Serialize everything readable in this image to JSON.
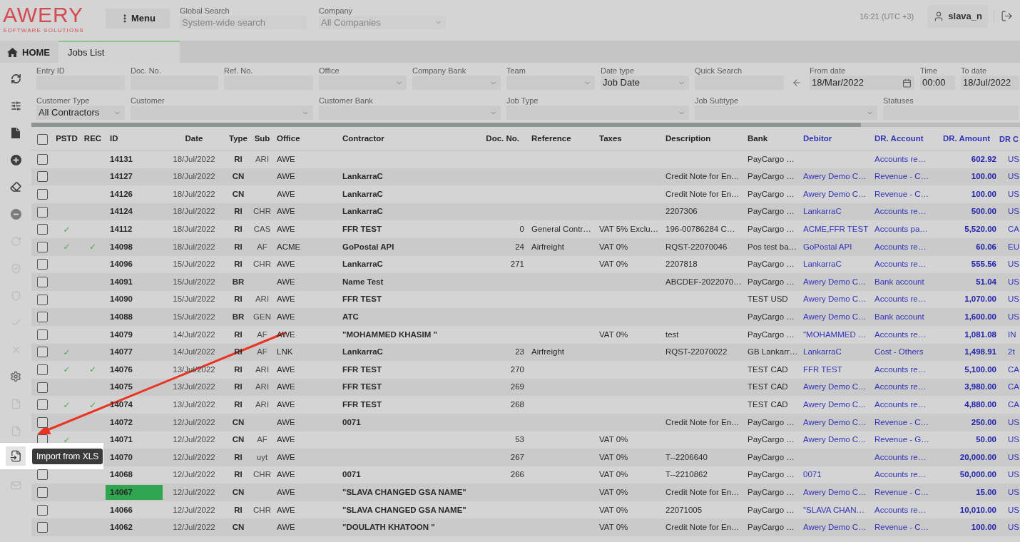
{
  "header": {
    "logo": {
      "name": "AWERY",
      "tagline": "SOFTWARE SOLUTIONS"
    },
    "menu_button": "Menu",
    "global_search": {
      "label": "Global Search",
      "placeholder": "System-wide search"
    },
    "company": {
      "label": "Company",
      "placeholder": "All Companies"
    },
    "time": "16:21 (UTC +3)",
    "user": "slava_n"
  },
  "tabs": [
    {
      "label": "HOME",
      "kind": "home",
      "selected": false
    },
    {
      "label": "Jobs List",
      "kind": "page",
      "selected": true
    }
  ],
  "sidebar": {
    "items": [
      {
        "kind": "refresh",
        "disabled": false
      },
      {
        "kind": "filters",
        "disabled": false
      },
      {
        "kind": "document",
        "disabled": false
      },
      {
        "kind": "add",
        "disabled": false
      },
      {
        "kind": "eraser",
        "disabled": false
      },
      {
        "kind": "remove",
        "disabled": false
      },
      {
        "kind": "redo",
        "disabled": true
      },
      {
        "kind": "shield_check",
        "disabled": true
      },
      {
        "kind": "shield",
        "disabled": true
      },
      {
        "kind": "check",
        "disabled": true
      },
      {
        "kind": "close",
        "disabled": true
      },
      {
        "kind": "settings",
        "disabled": false
      },
      {
        "kind": "export",
        "disabled": true
      },
      {
        "kind": "export",
        "disabled": true
      },
      {
        "kind": "import",
        "disabled": false,
        "tooltip": "Import from XLS"
      },
      {
        "kind": "mail",
        "disabled": true
      }
    ]
  },
  "filters": {
    "fields": [
      {
        "kind": "text",
        "label": "Entry ID"
      },
      {
        "kind": "text",
        "label": "Doc. No."
      },
      {
        "kind": "text",
        "label": "Ref. No."
      },
      {
        "kind": "select",
        "label": "Office"
      },
      {
        "kind": "select",
        "label": "Company Bank"
      },
      {
        "kind": "select",
        "label": "Team"
      },
      {
        "kind": "select",
        "label": "Date type",
        "value": "Job Date"
      },
      {
        "kind": "text",
        "label": "Quick Search"
      },
      {
        "kind": "arrow_button"
      },
      {
        "kind": "date",
        "label": "From date",
        "value": "18/Mar/2022"
      },
      {
        "kind": "time",
        "label": "Time",
        "value": "00:00"
      },
      {
        "kind": "time",
        "label": "To date",
        "value": "18/Jul/2022"
      },
      {
        "kind": "select",
        "label": "Customer Type",
        "value": "All Contractors"
      },
      {
        "kind": "select",
        "label": "Customer"
      },
      {
        "kind": "select",
        "label": "Customer Bank"
      },
      {
        "kind": "select",
        "label": "Job Type"
      },
      {
        "kind": "select",
        "label": "Job Subtype"
      },
      {
        "kind": "text",
        "label": "Statuses"
      }
    ]
  },
  "table": {
    "all_checked": false,
    "columns": [
      {
        "label": "PSTD",
        "kind": "tick"
      },
      {
        "label": "REC",
        "kind": "tick"
      },
      {
        "label": "ID",
        "kind": "id"
      },
      {
        "label": "Date",
        "kind": "date"
      },
      {
        "label": "Type",
        "kind": "type"
      },
      {
        "label": "Sub",
        "kind": "sub"
      },
      {
        "label": "Office",
        "kind": "text"
      },
      {
        "label": "Contractor",
        "kind": "name"
      },
      {
        "label": "Doc. No.",
        "kind": "number"
      },
      {
        "label": "Reference",
        "kind": "text"
      },
      {
        "label": "Taxes",
        "kind": "text"
      },
      {
        "label": "Description",
        "kind": "text"
      },
      {
        "label": "Bank",
        "kind": "text"
      },
      {
        "label": "Debitor",
        "kind": "link"
      },
      {
        "label": "DR. Account",
        "kind": "link"
      },
      {
        "label": "DR. Amount",
        "kind": "amount"
      },
      {
        "label": "DR C",
        "kind": "currency"
      }
    ],
    "rows": [
      {
        "checked": false,
        "id_highlighted": false,
        "cells": [
          "",
          "",
          "14131",
          "18/Jul/2022",
          "RI",
          "ARI",
          "AWE",
          "",
          "",
          "",
          "",
          "",
          "PayCargo …",
          "",
          "Accounts re…",
          "602.92",
          "US"
        ]
      },
      {
        "checked": false,
        "id_highlighted": false,
        "cells": [
          "",
          "",
          "14127",
          "18/Jul/2022",
          "CN",
          "",
          "AWE",
          "LankarraC",
          "",
          "",
          "",
          "Credit Note for En…",
          "PayCargo …",
          "Awery Demo C…",
          "Revenue - C…",
          "100.00",
          "US"
        ]
      },
      {
        "checked": false,
        "id_highlighted": false,
        "cells": [
          "",
          "",
          "14126",
          "18/Jul/2022",
          "CN",
          "",
          "AWE",
          "LankarraC",
          "",
          "",
          "",
          "Credit Note for En…",
          "PayCargo …",
          "Awery Demo C…",
          "Revenue - C…",
          "100.00",
          "US"
        ]
      },
      {
        "checked": false,
        "id_highlighted": false,
        "cells": [
          "",
          "",
          "14124",
          "18/Jul/2022",
          "RI",
          "CHR",
          "AWE",
          "LankarraC",
          "",
          "",
          "",
          "2207306",
          "PayCargo …",
          "LankarraC",
          "Accounts re…",
          "500.00",
          "US"
        ]
      },
      {
        "checked": false,
        "id_highlighted": false,
        "cells": [
          "✓",
          "",
          "14112",
          "18/Jul/2022",
          "RI",
          "CAS",
          "AWE",
          "FFR TEST",
          "0",
          "General Contr…",
          "VAT 5% Exclu…",
          "196-00786284 C…",
          "PayCargo …",
          "ACME,FFR TEST",
          "Accounts pa…",
          "5,520.00",
          "CA"
        ]
      },
      {
        "checked": false,
        "id_highlighted": false,
        "cells": [
          "✓",
          "✓",
          "14098",
          "18/Jul/2022",
          "RI",
          "AF",
          "ACME",
          "GoPostal API",
          "24",
          "Airfreight",
          "VAT 0%",
          "RQST-22070046",
          "Pos test ba…",
          "GoPostal API",
          "Accounts re…",
          "60.06",
          "EU"
        ]
      },
      {
        "checked": false,
        "id_highlighted": false,
        "cells": [
          "",
          "",
          "14096",
          "15/Jul/2022",
          "RI",
          "CHR",
          "AWE",
          "LankarraC",
          "271",
          "",
          "VAT 0%",
          "2207818",
          "PayCargo …",
          "LankarraC",
          "Accounts re…",
          "555.56",
          "US"
        ]
      },
      {
        "checked": false,
        "id_highlighted": false,
        "cells": [
          "",
          "",
          "14091",
          "15/Jul/2022",
          "BR",
          "",
          "AWE",
          "Name Test",
          "",
          "",
          "",
          "ABCDEF-2022070…",
          "PayCargo …",
          "Awery Demo C…",
          "Bank account",
          "51.04",
          "US"
        ]
      },
      {
        "checked": false,
        "id_highlighted": false,
        "cells": [
          "",
          "",
          "14090",
          "15/Jul/2022",
          "RI",
          "ARI",
          "AWE",
          "FFR TEST",
          "",
          "",
          "",
          "",
          "TEST USD",
          "Awery Demo C…",
          "Accounts re…",
          "1,070.00",
          "US"
        ]
      },
      {
        "checked": false,
        "id_highlighted": false,
        "cells": [
          "",
          "",
          "14088",
          "15/Jul/2022",
          "BR",
          "GEN",
          "AWE",
          "ATC",
          "",
          "",
          "",
          "",
          "PayCargo …",
          "Awery Demo C…",
          "Bank account",
          "1,600.00",
          "US"
        ]
      },
      {
        "checked": false,
        "id_highlighted": false,
        "cells": [
          "",
          "",
          "14079",
          "14/Jul/2022",
          "RI",
          "AF",
          "AWE",
          "\"MOHAMMED KHASIM \"",
          "",
          "",
          "VAT 0%",
          "test",
          "PayCargo …",
          "\"MOHAMMED …",
          "Accounts re…",
          "1,081.08",
          "IN"
        ]
      },
      {
        "checked": false,
        "id_highlighted": false,
        "cells": [
          "✓",
          "",
          "14077",
          "14/Jul/2022",
          "RI",
          "AF",
          "LNK",
          "LankarraC",
          "23",
          "Airfreight",
          "",
          "RQST-22070022",
          "GB Lankarr…",
          "LankarraC",
          "Cost - Others",
          "1,498.91",
          "2t"
        ]
      },
      {
        "checked": false,
        "id_highlighted": false,
        "cells": [
          "✓",
          "✓",
          "14076",
          "13/Jul/2022",
          "RI",
          "ARI",
          "AWE",
          "FFR TEST",
          "270",
          "",
          "",
          "",
          "TEST CAD",
          "FFR TEST",
          "Accounts re…",
          "5,100.00",
          "CA"
        ]
      },
      {
        "checked": false,
        "id_highlighted": false,
        "cells": [
          "",
          "",
          "14075",
          "13/Jul/2022",
          "RI",
          "ARI",
          "AWE",
          "FFR TEST",
          "269",
          "",
          "",
          "",
          "TEST CAD",
          "Awery Demo C…",
          "Accounts re…",
          "3,980.00",
          "CA"
        ]
      },
      {
        "checked": false,
        "id_highlighted": false,
        "cells": [
          "✓",
          "✓",
          "14074",
          "13/Jul/2022",
          "RI",
          "ARI",
          "AWE",
          "FFR TEST",
          "268",
          "",
          "",
          "",
          "TEST CAD",
          "Awery Demo C…",
          "Accounts re…",
          "4,880.00",
          "CA"
        ]
      },
      {
        "checked": false,
        "id_highlighted": false,
        "cells": [
          "",
          "",
          "14072",
          "12/Jul/2022",
          "CN",
          "",
          "AWE",
          "0071",
          "",
          "",
          "",
          "Credit Note for En…",
          "PayCargo …",
          "Awery Demo C…",
          "Revenue - C…",
          "250.00",
          "US"
        ]
      },
      {
        "checked": false,
        "id_highlighted": false,
        "cells": [
          "✓",
          "",
          "14071",
          "12/Jul/2022",
          "CN",
          "AF",
          "AWE",
          "",
          "53",
          "",
          "VAT 0%",
          "",
          "PayCargo …",
          "Awery Demo C…",
          "Revenue - G…",
          "50.00",
          "US"
        ]
      },
      {
        "id_highlighted": false,
        "cells": [
          "",
          "",
          "14070",
          "12/Jul/2022",
          "RI",
          "uyt",
          "AWE",
          "",
          "267",
          "",
          "VAT 0%",
          "T--2206640",
          "PayCargo …",
          "",
          "Accounts re…",
          "20,000.00",
          "US"
        ]
      },
      {
        "checked": false,
        "id_highlighted": false,
        "cells": [
          "",
          "",
          "14068",
          "12/Jul/2022",
          "RI",
          "CHR",
          "AWE",
          "0071",
          "266",
          "",
          "VAT 0%",
          "T--2210862",
          "PayCargo …",
          "0071",
          "Accounts re…",
          "50,000.00",
          "US"
        ]
      },
      {
        "checked": false,
        "id_highlighted": true,
        "cells": [
          "",
          "",
          "14067",
          "12/Jul/2022",
          "CN",
          "",
          "AWE",
          "\"SLAVA CHANGED GSA NAME\"",
          "",
          "",
          "VAT 0%",
          "Credit Note for En…",
          "PayCargo …",
          "Awery Demo C…",
          "Revenue - C…",
          "15.00",
          "US"
        ]
      },
      {
        "checked": false,
        "id_highlighted": false,
        "cells": [
          "",
          "",
          "14066",
          "12/Jul/2022",
          "RI",
          "CHR",
          "AWE",
          "\"SLAVA CHANGED GSA NAME\"",
          "",
          "",
          "VAT 0%",
          "22071005",
          "PayCargo …",
          "\"SLAVA CHAN…",
          "Accounts re…",
          "10,010.00",
          "US"
        ]
      },
      {
        "checked": false,
        "id_highlighted": false,
        "cells": [
          "",
          "",
          "14062",
          "12/Jul/2022",
          "CN",
          "",
          "AWE",
          "\"DOULATH KHATOON \"",
          "",
          "",
          "VAT 0%",
          "Credit Note for En…",
          "PayCargo …",
          "Awery Demo C…",
          "Revenue - C…",
          "100.00",
          "US"
        ]
      }
    ]
  }
}
